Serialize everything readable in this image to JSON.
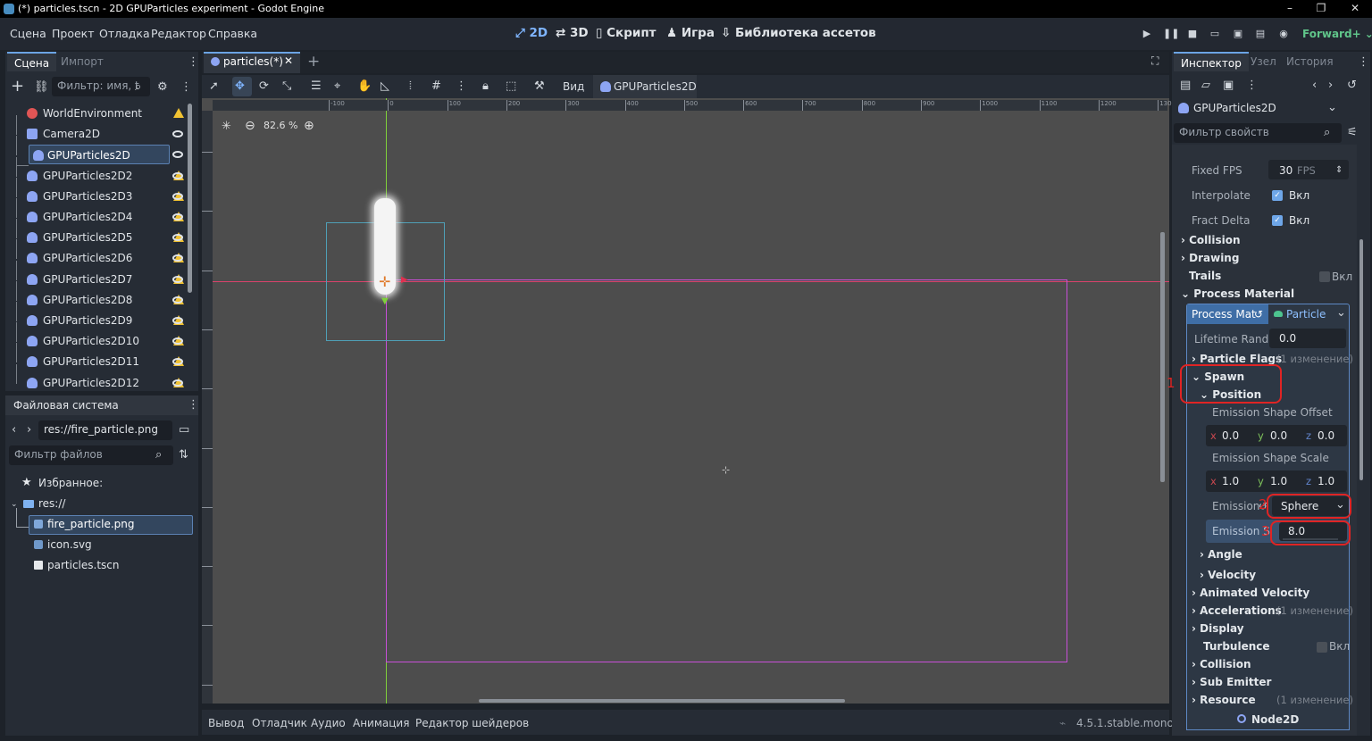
{
  "window": {
    "title": "(*) particles.tscn - 2D GPUParticles experiment - Godot Engine",
    "controls": [
      "–",
      "❐",
      "✕"
    ]
  },
  "menu": {
    "items": [
      "Сцена",
      "Проект",
      "Отладка",
      "Редактор",
      "Справка"
    ]
  },
  "main_screens": {
    "items": [
      "2D",
      "3D",
      "Скрипт",
      "Игра",
      "Библиотека ассетов"
    ],
    "active": "2D"
  },
  "renderer": "Forward+",
  "scene_dock": {
    "tabs": [
      "Сцена",
      "Импорт"
    ],
    "filter_placeholder": "Фильтр: имя, t",
    "nodes": [
      {
        "label": "WorldEnvironment",
        "warn": true,
        "eye": false
      },
      {
        "label": "Camera2D",
        "warn": false,
        "eye": true
      },
      {
        "label": "GPUParticles2D",
        "warn": false,
        "eye": true,
        "selected": true
      },
      {
        "label": "GPUParticles2D2",
        "warn": true,
        "eye": true
      },
      {
        "label": "GPUParticles2D3",
        "warn": true,
        "eye": true
      },
      {
        "label": "GPUParticles2D4",
        "warn": true,
        "eye": true
      },
      {
        "label": "GPUParticles2D5",
        "warn": true,
        "eye": true
      },
      {
        "label": "GPUParticles2D6",
        "warn": true,
        "eye": true
      },
      {
        "label": "GPUParticles2D7",
        "warn": true,
        "eye": true
      },
      {
        "label": "GPUParticles2D8",
        "warn": true,
        "eye": true
      },
      {
        "label": "GPUParticles2D9",
        "warn": true,
        "eye": true
      },
      {
        "label": "GPUParticles2D10",
        "warn": true,
        "eye": true
      },
      {
        "label": "GPUParticles2D11",
        "warn": true,
        "eye": true
      },
      {
        "label": "GPUParticles2D12",
        "warn": true,
        "eye": true
      }
    ]
  },
  "filesystem": {
    "title": "Файловая система",
    "path": "res://fire_particle.png",
    "filter_placeholder": "Фильтр файлов",
    "favorites": "Избранное:",
    "root": "res://",
    "files": [
      "fire_particle.png",
      "icon.svg",
      "particles.tscn"
    ]
  },
  "editor": {
    "tab": "particles(*)",
    "view_label": "Вид",
    "node_label": "GPUParticles2D",
    "zoom": "82.6 %",
    "ruler_ticks": [
      "-100",
      "0",
      "100",
      "200",
      "300",
      "400",
      "500",
      "600",
      "700",
      "800",
      "900",
      "1000",
      "1100",
      "1200",
      "1300"
    ]
  },
  "bottom": {
    "tabs": [
      "Вывод",
      "Отладчик",
      "Аудио",
      "Анимация",
      "Редактор шейдеров"
    ],
    "version": "4.5.1.stable.mono"
  },
  "inspector": {
    "tabs": [
      "Инспектор",
      "Узел",
      "История"
    ],
    "object": "GPUParticles2D",
    "filter_placeholder": "Фильтр свойств",
    "fixed_fps_label": "Fixed FPS",
    "fixed_fps": "30",
    "fps_unit": "FPS",
    "interpolate_label": "Interpolate",
    "on": "Вкл",
    "fract_label": "Fract Delta",
    "sections": [
      "Collision",
      "Drawing",
      "Trails",
      "Process Material"
    ],
    "process_mat_label": "Process Mat",
    "process_mat_value": "Particle",
    "lifetime_label": "Lifetime Rand",
    "lifetime": "0.0",
    "particle_flags": "Particle Flags",
    "one_change": "(1 изменение)",
    "spawn": "Spawn",
    "position": "Position",
    "shape_offset": "Emission Shape Offset",
    "offset": {
      "x": "0.0",
      "y": "0.0",
      "z": "0.0"
    },
    "shape_scale": "Emission Shape Scale",
    "scale": {
      "x": "1.0",
      "y": "1.0",
      "z": "1.0"
    },
    "emission_label": "Emission",
    "emission_shape": "Sphere",
    "emission_radius_label": "Emission S",
    "emission_radius": "8.0",
    "groups": [
      "Angle",
      "Velocity",
      "Animated Velocity",
      "Accelerations",
      "Display",
      "Turbulence",
      "Collision",
      "Sub Emitter",
      "Resource"
    ],
    "footer": "Node2D",
    "annotations": [
      "1",
      "2",
      "3"
    ]
  }
}
